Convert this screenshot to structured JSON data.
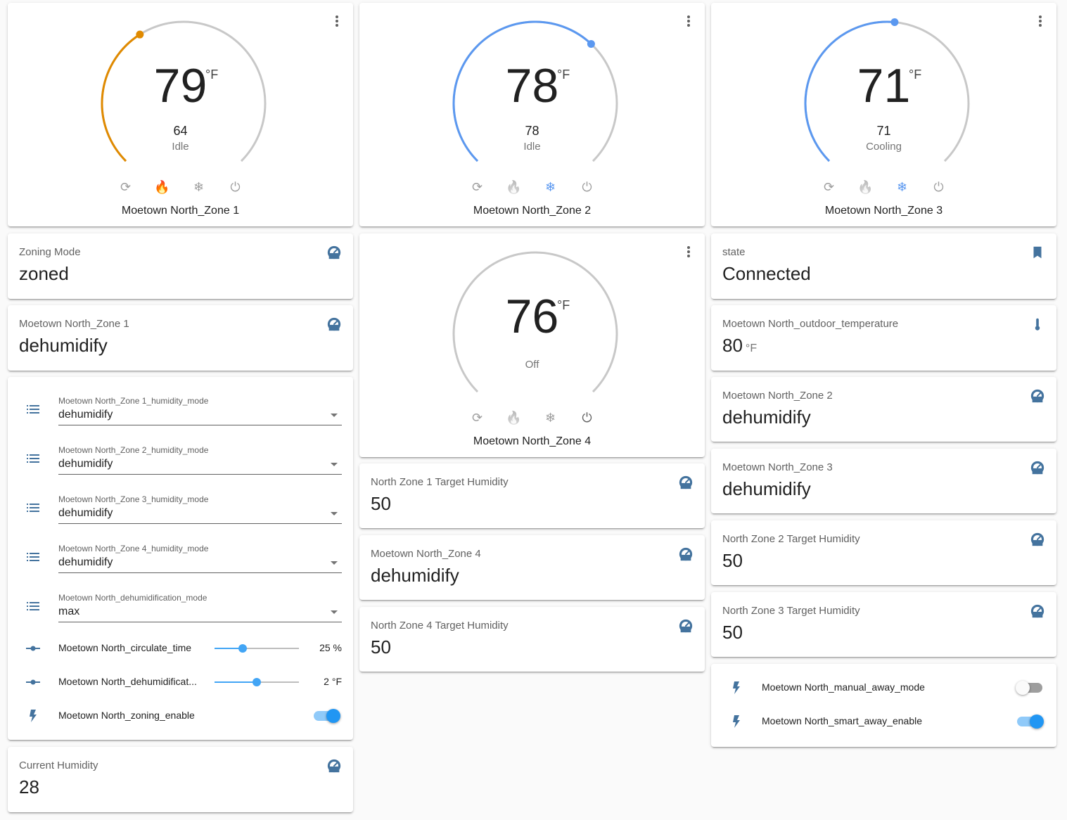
{
  "colors": {
    "heat": "#e08a00",
    "cool": "#5b98f0",
    "track": "#c8c8c8",
    "accent": "#2196f3",
    "icon": "#44739e"
  },
  "thermostats": [
    {
      "current": "79",
      "unit": "°F",
      "target": "64",
      "state": "Idle",
      "name": "Moetown North_Zone 1",
      "active_mode": "heat"
    },
    {
      "current": "78",
      "unit": "°F",
      "target": "78",
      "state": "Idle",
      "name": "Moetown North_Zone 2",
      "active_mode": "cool"
    },
    {
      "current": "71",
      "unit": "°F",
      "target": "71",
      "state": "Cooling",
      "name": "Moetown North_Zone 3",
      "active_mode": "cool"
    },
    {
      "current": "76",
      "unit": "°F",
      "target": "",
      "state": "Off",
      "name": "Moetown North_Zone 4",
      "active_mode": "off"
    }
  ],
  "sensors": {
    "zoning_mode": {
      "title": "Zoning Mode",
      "value": "zoned",
      "icon": "gauge-icon"
    },
    "zone1_mode": {
      "title": "Moetown North_Zone 1",
      "value": "dehumidify",
      "icon": "gauge-icon"
    },
    "current_humidity": {
      "title": "Current Humidity",
      "value": "28",
      "icon": "gauge-icon"
    },
    "zone1_target_humidity": {
      "title": "North Zone 1 Target Humidity",
      "value": "50",
      "icon": "gauge-icon"
    },
    "zone4_mode": {
      "title": "Moetown North_Zone 4",
      "value": "dehumidify",
      "icon": "gauge-icon"
    },
    "zone4_target_humidity": {
      "title": "North Zone 4 Target Humidity",
      "value": "50",
      "icon": "gauge-icon"
    },
    "state": {
      "title": "state",
      "value": "Connected",
      "icon": "bookmark-icon"
    },
    "outdoor_temp": {
      "title": "Moetown North_outdoor_temperature",
      "value": "80",
      "unit": "°F",
      "icon": "thermometer-icon"
    },
    "zone2_mode": {
      "title": "Moetown North_Zone 2",
      "value": "dehumidify",
      "icon": "gauge-icon"
    },
    "zone3_mode": {
      "title": "Moetown North_Zone 3",
      "value": "dehumidify",
      "icon": "gauge-icon"
    },
    "zone2_target_humidity": {
      "title": "North Zone 2 Target Humidity",
      "value": "50",
      "icon": "gauge-icon"
    },
    "zone3_target_humidity": {
      "title": "North Zone 3 Target Humidity",
      "value": "50",
      "icon": "gauge-icon"
    }
  },
  "entities": {
    "selects": [
      {
        "label": "Moetown North_Zone 1_humidity_mode",
        "value": "dehumidify"
      },
      {
        "label": "Moetown North_Zone 2_humidity_mode",
        "value": "dehumidify"
      },
      {
        "label": "Moetown North_Zone 3_humidity_mode",
        "value": "dehumidify"
      },
      {
        "label": "Moetown North_Zone 4_humidity_mode",
        "value": "dehumidify"
      },
      {
        "label": "Moetown North_dehumidification_mode",
        "value": "max"
      }
    ],
    "sliders": [
      {
        "name": "Moetown North_circulate_time",
        "value_text": "25 %",
        "fraction": 0.33
      },
      {
        "name": "Moetown North_dehumidificat...",
        "value_text": "2 °F",
        "fraction": 0.5
      }
    ],
    "switches": [
      {
        "name": "Moetown North_zoning_enable",
        "on": true
      }
    ]
  },
  "away_switches": [
    {
      "name": "Moetown North_manual_away_mode",
      "on": false
    },
    {
      "name": "Moetown North_smart_away_enable",
      "on": true
    }
  ]
}
